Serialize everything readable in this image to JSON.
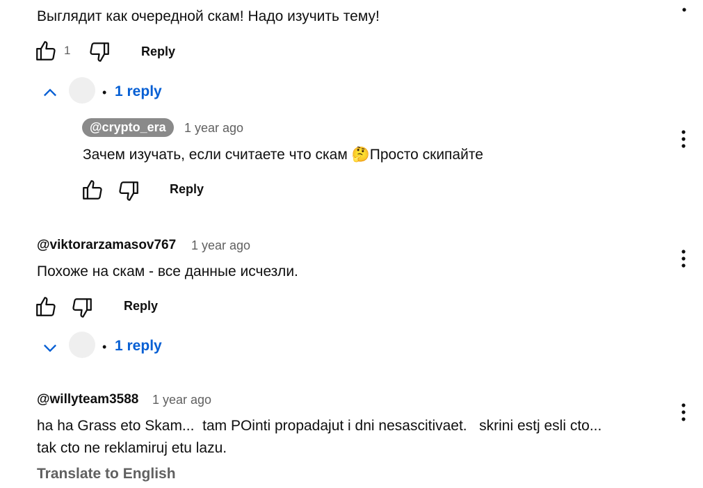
{
  "comment1": {
    "text": "Выглядит как очередной скам! Надо изучить тему!",
    "like_count": "1",
    "reply_label": "Reply",
    "replies_toggle": "1 reply",
    "separator": "•"
  },
  "reply1": {
    "author": "@crypto_era",
    "time": "1 year ago",
    "text_before": "Зачем изучать, если считаете что скам",
    "emoji": "🤔",
    "text_after": "Просто скипайте",
    "reply_label": "Reply"
  },
  "comment2": {
    "author": "@viktorarzamasov767",
    "time": "1 year ago",
    "text": "Похоже на скам - все данные исчезли.",
    "reply_label": "Reply",
    "replies_toggle": "1 reply",
    "separator": "•"
  },
  "comment3": {
    "author": "@willyteam3588",
    "time": "1 year ago",
    "text_line1": "ha ha Grass eto Skam...  tam POinti propadajut i dni nesascitivaet.   skrini estj esli cto...",
    "text_line2": "tak cto ne reklamiruj etu lazu.",
    "translate_label": "Translate to English"
  },
  "icons": {
    "like": "thumbs-up-icon",
    "dislike": "thumbs-down-icon",
    "more": "more-vert-icon",
    "collapse": "chevron-up-icon",
    "expand": "chevron-down-icon"
  },
  "colors": {
    "link": "#065fd4",
    "secondary_text": "#606060",
    "author_chip": "#8a8a8a"
  }
}
